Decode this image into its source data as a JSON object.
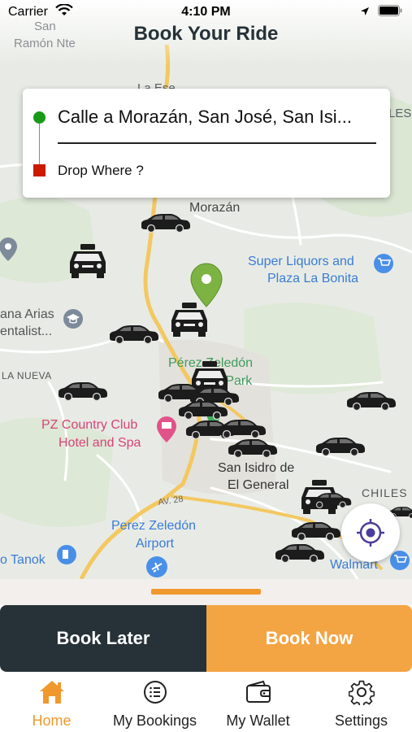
{
  "status_bar": {
    "carrier": "Carrier",
    "time": "4:10 PM"
  },
  "header": {
    "title": "Book Your Ride"
  },
  "location_card": {
    "pickup": "Calle a Morazán, San José, San Isi...",
    "dropoff": "Drop Where ?"
  },
  "map": {
    "labels": {
      "san": "San",
      "ramon": "Ramón Nte",
      "laese": "La Ese",
      "les": "LES",
      "morazan": "Morazán",
      "super1": "Super Liquors and",
      "super2": "Plaza La Bonita",
      "ana1": "ana Arias",
      "ana2": "entalist...",
      "lanueva": "LA NUEVA",
      "perez1": "Pérez Zeledón",
      "perez2": "Club Park",
      "pz1": "PZ Country Club",
      "pz2": "Hotel and Spa",
      "sanisidro1": "San Isidro de",
      "sanisidro2": "El General",
      "av28": "AV. 28",
      "chiles": "CHILES",
      "airport1": "Perez Zeledón",
      "airport2": "Airport",
      "tanok": "o Tanok",
      "walmart": "Walmart"
    }
  },
  "actions": {
    "book_later": "Book Later",
    "book_now": "Book Now"
  },
  "tabs": [
    {
      "label": "Home",
      "icon": "home-icon",
      "active": true
    },
    {
      "label": "My Bookings",
      "icon": "list-icon",
      "active": false
    },
    {
      "label": "My Wallet",
      "icon": "wallet-icon",
      "active": false
    },
    {
      "label": "Settings",
      "icon": "gear-icon",
      "active": false
    }
  ],
  "colors": {
    "accent": "#f3a443",
    "dark": "#263238",
    "pickup_marker": "#189a18",
    "drop_marker": "#cc1a00",
    "active_tab": "#f0982e"
  }
}
